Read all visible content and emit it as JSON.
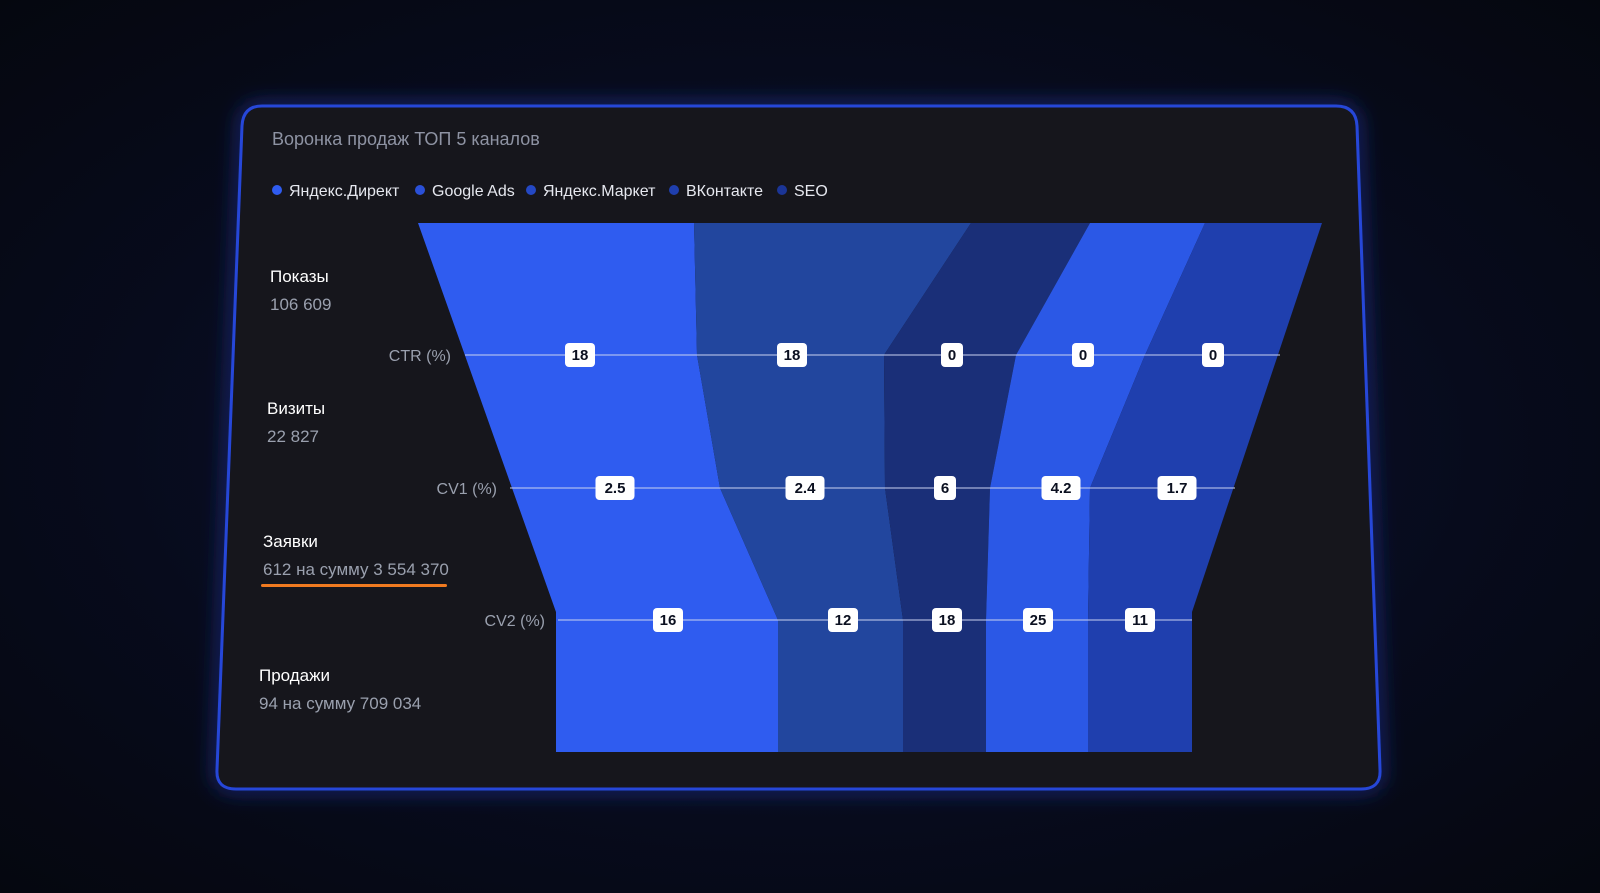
{
  "title": "Воронка продаж ТОП 5 каналов",
  "legend": [
    {
      "label": "Яндекс.Директ",
      "color": "#2f5cf0"
    },
    {
      "label": "Google Ads",
      "color": "#2a50d8"
    },
    {
      "label": "Яндекс.Маркет",
      "color": "#2448c4"
    },
    {
      "label": "ВКонтакте",
      "color": "#1f3fae"
    },
    {
      "label": "SEO",
      "color": "#1b3596"
    }
  ],
  "stages": [
    {
      "name": "Показы",
      "value": "106 609"
    },
    {
      "name": "Визиты",
      "value": "22 827"
    },
    {
      "name": "Заявки",
      "value": "612 на сумму 3 554 370",
      "highlight_color": "#f07a20"
    },
    {
      "name": "Продажи",
      "value": "94 на сумму 709 034"
    }
  ],
  "chart_data": {
    "type": "funnel",
    "title": "Воронка продаж ТОП 5 каналов",
    "series_names": [
      "Яндекс.Директ",
      "Google Ads",
      "Яндекс.Маркет",
      "ВКонтакте",
      "SEO"
    ],
    "colors": [
      "#2f5cf0",
      "#22469e",
      "#1a2f78",
      "#2b58e6",
      "#1f3fae"
    ],
    "metrics": [
      {
        "label": "CTR (%)",
        "values": [
          "18",
          "18",
          "0",
          "0",
          "0"
        ]
      },
      {
        "label": "CV1 (%)",
        "values": [
          "2.5",
          "2.4",
          "6",
          "4.2",
          "1.7"
        ]
      },
      {
        "label": "CV2 (%)",
        "values": [
          "16",
          "12",
          "18",
          "25",
          "11"
        ]
      }
    ]
  }
}
